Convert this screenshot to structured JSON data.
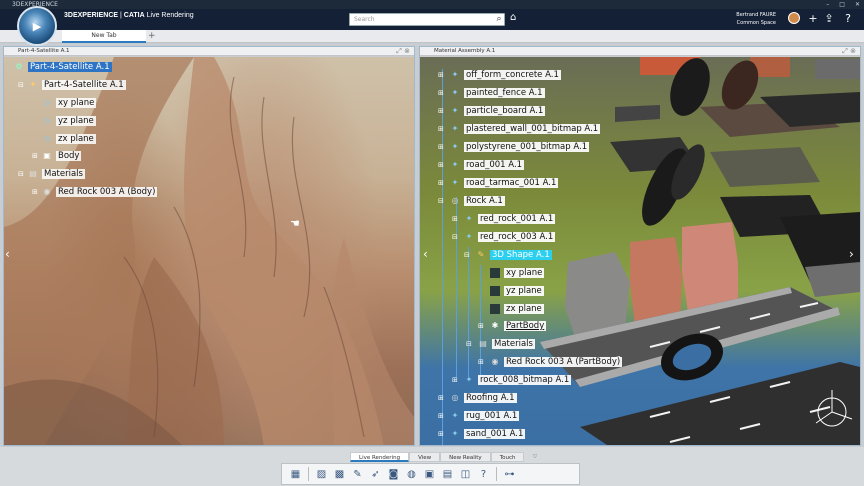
{
  "window": {
    "title": "3DEXPERIENCE"
  },
  "topbar": {
    "brand_prefix": "3DEXPERIENCE",
    "brand_sep": " | ",
    "brand_app": "CATIA",
    "brand_suffix": " Live Rendering",
    "search_placeholder": "Search",
    "user_name": "Bertrand FAURE",
    "user_space": "Common Space"
  },
  "tabs": [
    {
      "label": "New Tab"
    }
  ],
  "left_panel": {
    "title": "Part-4-Satellite A.1",
    "tree": [
      {
        "label": "Part-4-Satellite A.1",
        "selected": true
      },
      {
        "label": "Part-4-Satellite A.1"
      },
      {
        "label": "xy plane"
      },
      {
        "label": "yz plane"
      },
      {
        "label": "zx plane"
      },
      {
        "label": "Body"
      },
      {
        "label": "Materials"
      },
      {
        "label": "Red Rock 003 A (Body)"
      }
    ]
  },
  "right_panel": {
    "title": "Material Assembly A.1",
    "tree": [
      {
        "label": "off_form_concrete A.1"
      },
      {
        "label": "painted_fence A.1"
      },
      {
        "label": "particle_board A.1"
      },
      {
        "label": "plastered_wall_001_bitmap A.1"
      },
      {
        "label": "polystyrene_001_bitmap A.1"
      },
      {
        "label": "road_001 A.1"
      },
      {
        "label": "road_tarmac_001 A.1"
      },
      {
        "label": "Rock A.1"
      },
      {
        "label": "red_rock_001 A.1"
      },
      {
        "label": "red_rock_003 A.1"
      },
      {
        "label": "3D Shape A.1",
        "highlighted": true
      },
      {
        "label": "xy plane"
      },
      {
        "label": "yz plane"
      },
      {
        "label": "zx plane"
      },
      {
        "label": "PartBody"
      },
      {
        "label": "Materials"
      },
      {
        "label": "Red Rock 003 A (PartBody)"
      },
      {
        "label": "rock_008_bitmap A.1"
      },
      {
        "label": "Roofing A.1"
      },
      {
        "label": "rug_001 A.1"
      },
      {
        "label": "sand_001 A.1"
      }
    ]
  },
  "bottom": {
    "tabs": [
      {
        "label": "Live Rendering",
        "active": true
      },
      {
        "label": "View"
      },
      {
        "label": "New Reality"
      },
      {
        "label": "Touch"
      }
    ]
  },
  "colors": {
    "selection": "#2e74c4",
    "highlight": "#2bd0f0",
    "topbar": "#132036"
  }
}
